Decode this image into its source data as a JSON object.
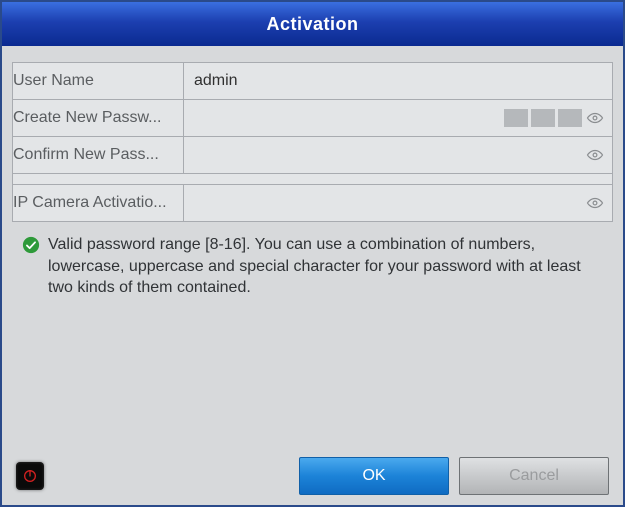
{
  "window": {
    "title": "Activation"
  },
  "form": {
    "rows": [
      {
        "label": "User Name",
        "value": "admin",
        "type": "text"
      },
      {
        "label": "Create New Passw...",
        "value": "",
        "type": "password",
        "show_strength": true,
        "show_eye": true
      },
      {
        "label": "Confirm New Pass...",
        "value": "",
        "type": "password",
        "show_eye": true
      }
    ],
    "ip_row": {
      "label": "IP Camera Activatio...",
      "value": "",
      "type": "password",
      "show_eye": true
    }
  },
  "hint": {
    "icon": "check-circle-icon",
    "text": "Valid password range [8-16]. You can use a combination of numbers, lowercase, uppercase and special character for your password with at least two kinds of them contained."
  },
  "footer": {
    "power_icon": "power-icon",
    "ok_label": "OK",
    "cancel_label": "Cancel"
  },
  "colors": {
    "accent": "#1c83d8"
  }
}
